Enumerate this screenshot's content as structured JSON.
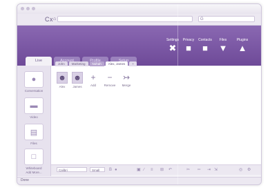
{
  "browser": {
    "nav_icons": [
      "C",
      "x",
      "⌂"
    ],
    "url": "",
    "search_glyph": "G"
  },
  "header": {
    "tools": [
      {
        "label": "Settings",
        "icon": "wrench-icon",
        "glyph": "✖"
      },
      {
        "label": "Privacy",
        "icon": "lock-icon",
        "glyph": "🔒"
      },
      {
        "label": "Contacts",
        "icon": "book-icon",
        "glyph": "■"
      },
      {
        "label": "Files",
        "icon": "folder-icon",
        "glyph": "▼"
      },
      {
        "label": "Plugins",
        "icon": "plugin-icon",
        "glyph": "▲"
      }
    ],
    "main_tabs": [
      "Live",
      "Account",
      "Profile",
      "Setup"
    ]
  },
  "subtabs": [
    "John",
    "Marketing",
    "Nohah",
    "Alex, James",
    "+"
  ],
  "sidebar": {
    "items": [
      {
        "label": "Conversation",
        "glyph": "●"
      },
      {
        "label": "Video",
        "glyph": "▬"
      },
      {
        "label": "Files",
        "glyph": "▤"
      },
      {
        "label": "Whiteboard",
        "glyph": "□"
      },
      {
        "label": "Add More...",
        "glyph": ""
      }
    ]
  },
  "participants": [
    {
      "name": "Alex",
      "glyph": "☻"
    },
    {
      "name": "James",
      "glyph": "☻"
    }
  ],
  "actions": [
    {
      "label": "Add",
      "glyph": "+"
    },
    {
      "label": "Remove",
      "glyph": "−"
    },
    {
      "label": "Merge",
      "glyph": "↣"
    }
  ],
  "toolbar": {
    "font": "Calibri",
    "size": "Small"
  },
  "status": "Done"
}
